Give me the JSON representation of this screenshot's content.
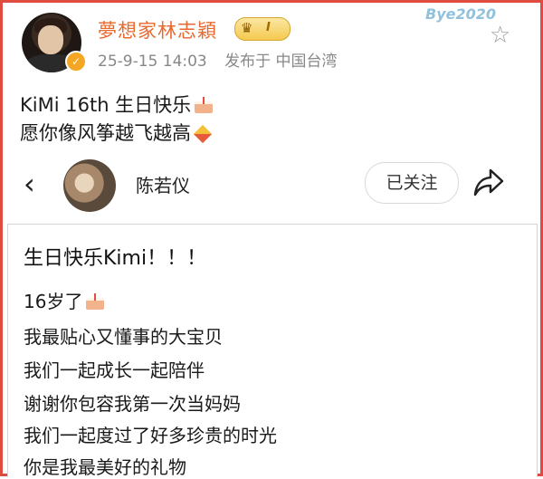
{
  "post": {
    "username": "夢想家林志穎",
    "badge_level": "I",
    "timestamp": "25-9-15 14:03",
    "location": "发布于 中国台湾",
    "watermark": "Bye2020",
    "text_line1": "KiMi 16th 生日快乐",
    "text_line2": "愿你像风筝越飞越高"
  },
  "repost": {
    "name": "陈若仪",
    "follow_label": "已关注"
  },
  "quoted": {
    "title": "生日快乐Kimi！！！",
    "lines": [
      "16岁了",
      "我最贴心又懂事的大宝贝",
      "我们一起成长一起陪伴",
      "谢谢你包容我第一次当妈妈",
      "我们一起度过了好多珍贵的时光",
      "你是我最美好的礼物"
    ]
  },
  "icons": {
    "star": "star-icon",
    "back": "chevron-left-icon",
    "share": "share-icon",
    "verified": "verified-icon",
    "crown": "crown-icon"
  },
  "colors": {
    "username": "#e8692e",
    "frame": "#e04b3f",
    "meta": "#888888"
  }
}
